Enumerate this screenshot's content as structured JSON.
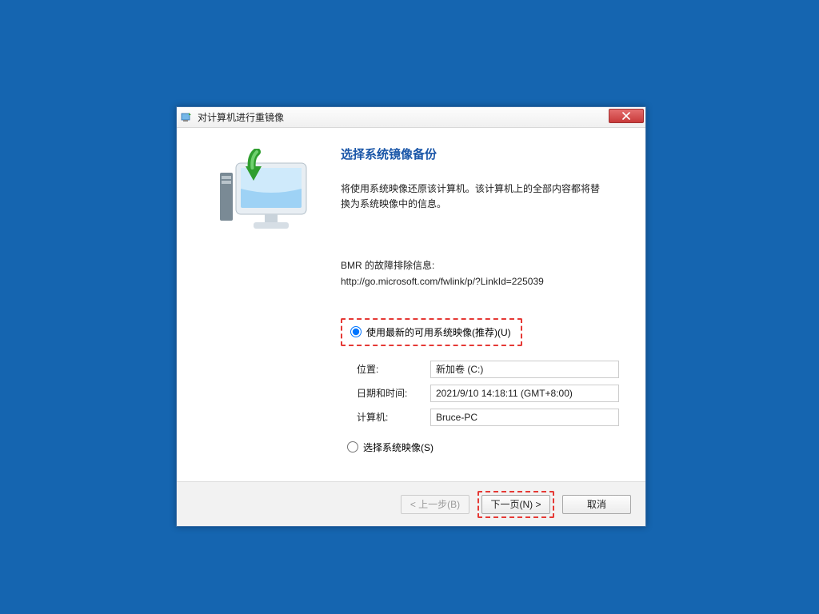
{
  "window": {
    "title": "对计算机进行重镜像"
  },
  "heading": "选择系统镜像备份",
  "description_line1": "将使用系统映像还原该计算机。该计算机上的全部内容都将替",
  "description_line2": "换为系统映像中的信息。",
  "bmr_label": "BMR 的故障排除信息:",
  "bmr_link": "http://go.microsoft.com/fwlink/p/?LinkId=225039",
  "radio1_label": "使用最新的可用系统映像(推荐)(U)",
  "radio2_label": "选择系统映像(S)",
  "fields": {
    "location_label": "位置:",
    "location_value": "新加卷 (C:)",
    "datetime_label": "日期和时间:",
    "datetime_value": "2021/9/10 14:18:11 (GMT+8:00)",
    "computer_label": "计算机:",
    "computer_value": "Bruce-PC"
  },
  "buttons": {
    "back": "< 上一步(B)",
    "next": "下一页(N) >",
    "cancel": "取消"
  }
}
